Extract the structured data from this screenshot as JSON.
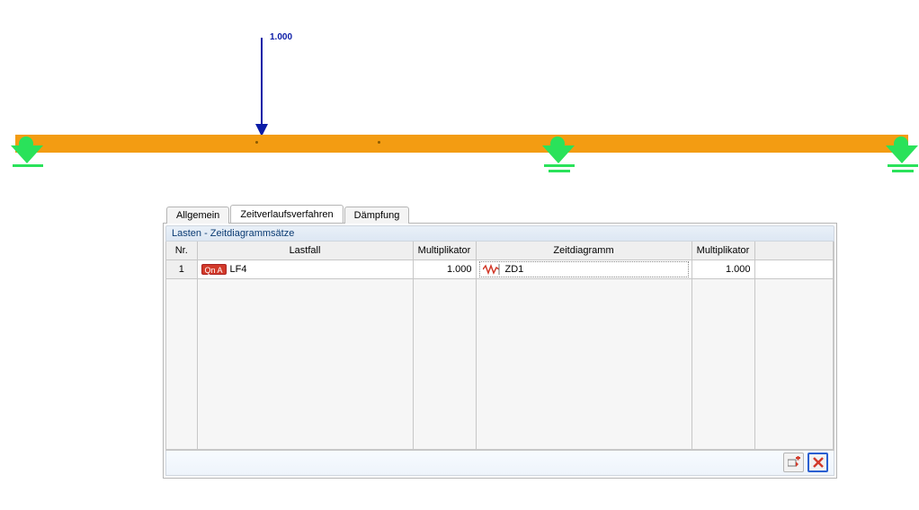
{
  "diagram": {
    "load_value": "1.000"
  },
  "tabs": {
    "general": "Allgemein",
    "timehistory": "Zeitverlaufsverfahren",
    "damping": "Dämpfung"
  },
  "group": {
    "title": "Lasten - Zeitdiagrammsätze"
  },
  "columns": {
    "nr": "Nr.",
    "loadcase": "Lastfall",
    "mult1": "Multiplikator",
    "timediagram": "Zeitdiagramm",
    "mult2": "Multiplikator"
  },
  "rows": [
    {
      "nr": "1",
      "lc_badge": "Qn A",
      "lc_name": "LF4",
      "mult1": "1.000",
      "td_name": "ZD1",
      "mult2": "1.000"
    }
  ]
}
